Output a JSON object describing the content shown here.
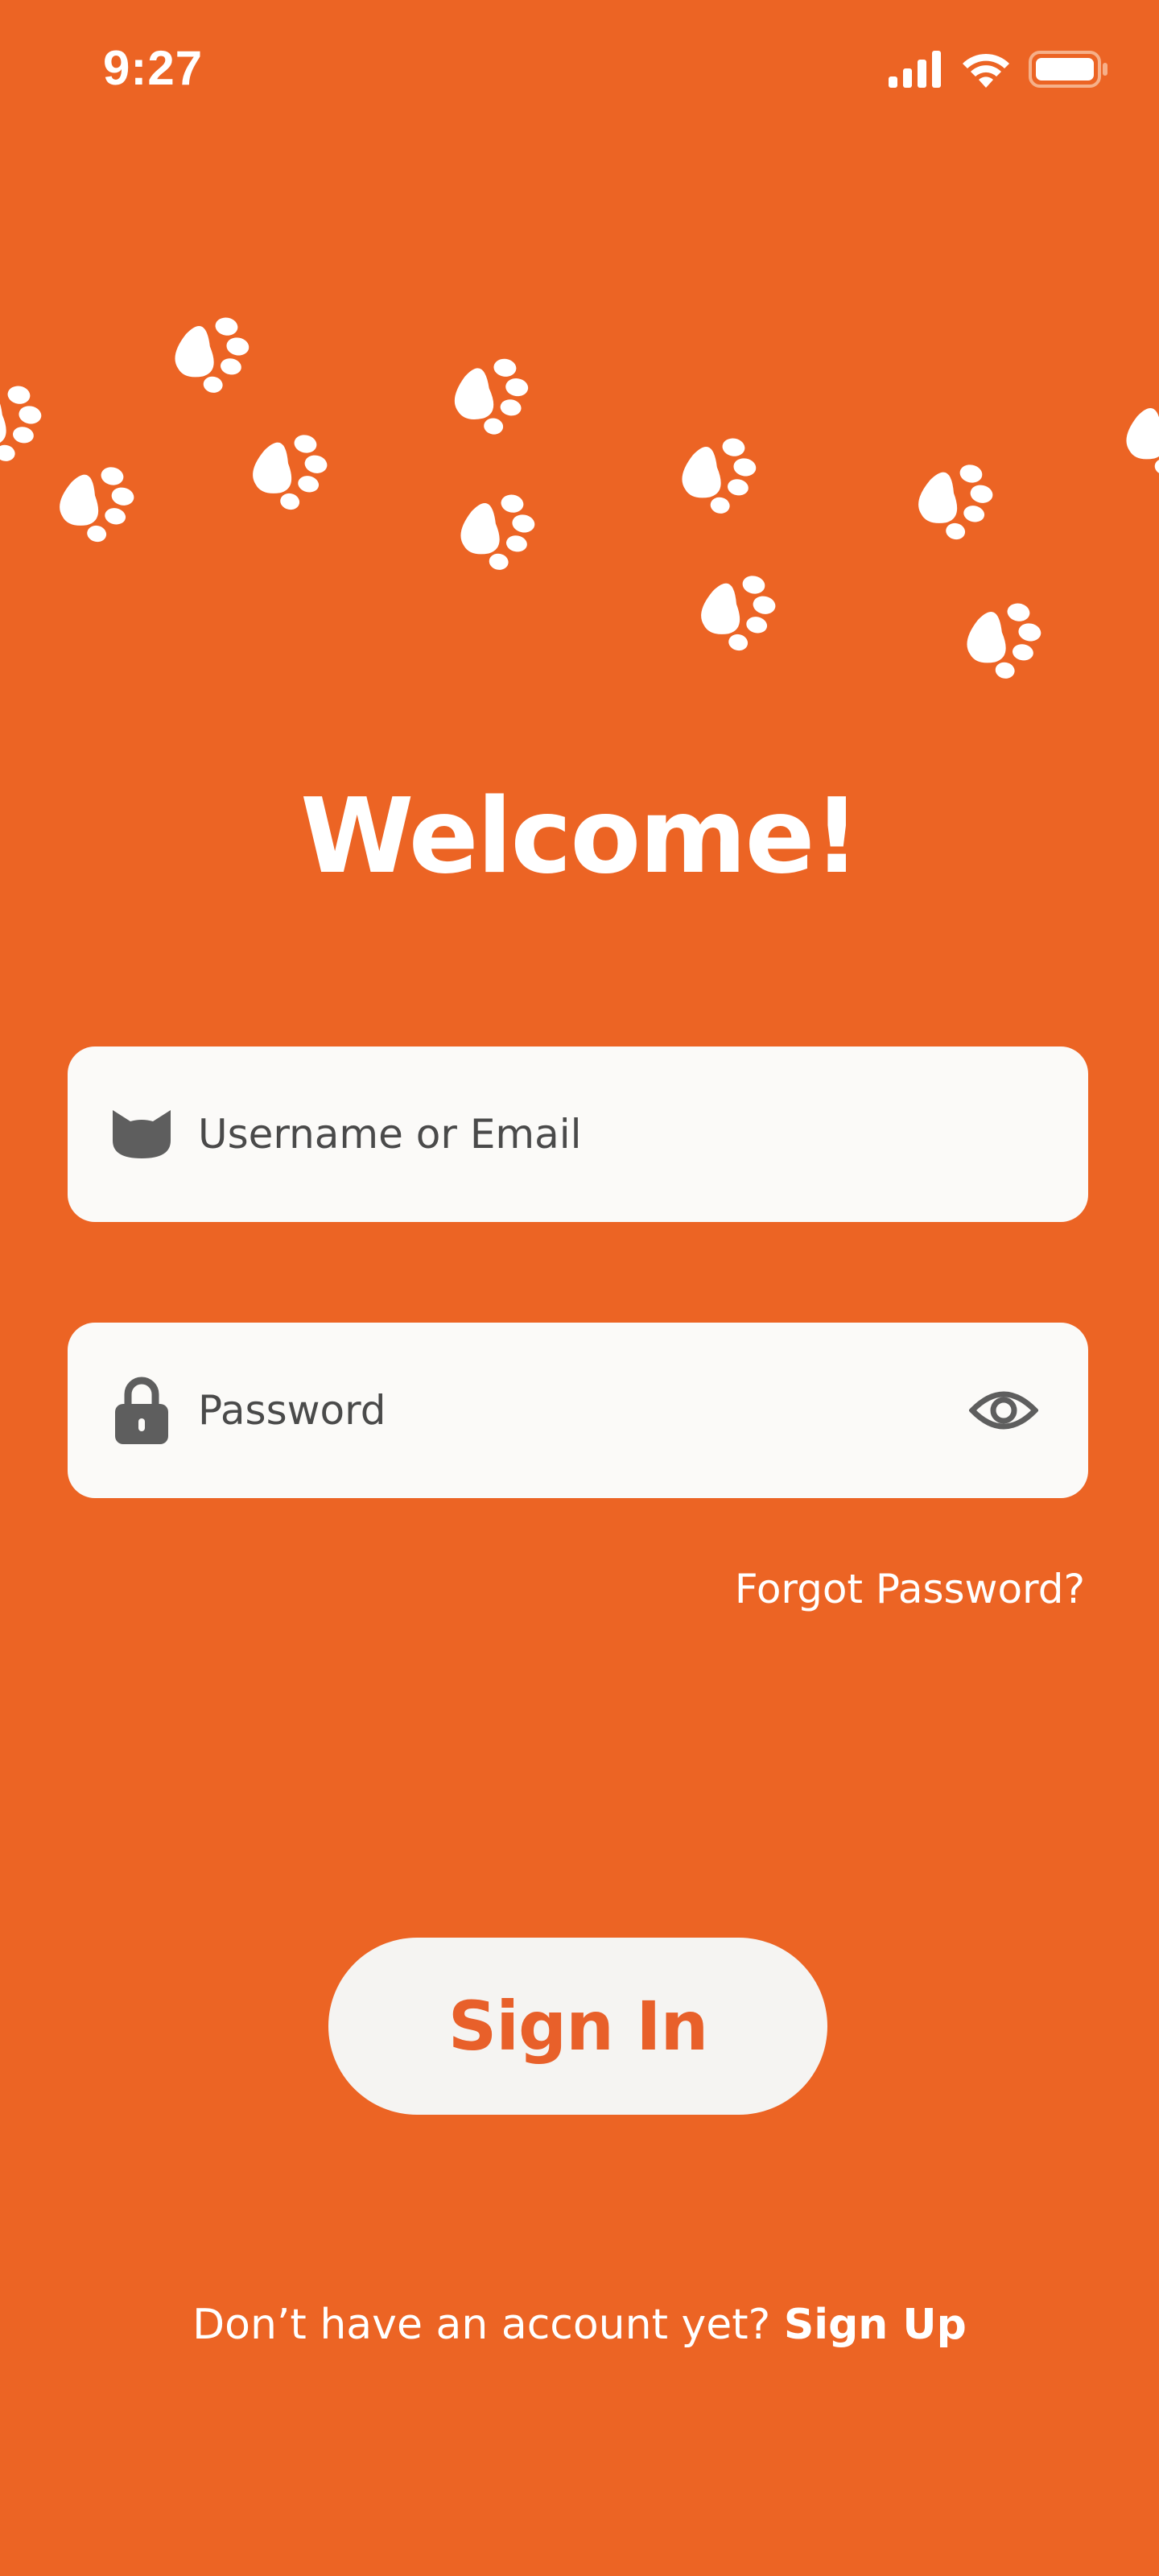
{
  "status_bar": {
    "time": "9:27",
    "icons": [
      "cellular-signal-icon",
      "wifi-icon",
      "battery-icon"
    ]
  },
  "decor": {
    "icon": "paw-print-icon",
    "color": "#FFFFFF"
  },
  "header": {
    "title": "Welcome!"
  },
  "form": {
    "username": {
      "placeholder": "Username or Email",
      "icon": "cat-face-icon"
    },
    "password": {
      "placeholder": "Password",
      "icon": "lock-icon",
      "toggle_icon": "eye-icon"
    },
    "forgot_label": "Forgot Password?",
    "submit_label": "Sign In"
  },
  "footer": {
    "prompt": "Don’t have an account yet?",
    "signup_label": "Sign Up"
  },
  "colors": {
    "background": "#EC6424",
    "field_bg": "#FBFAF8",
    "button_bg": "#F5F4F2",
    "button_text": "#E8602A",
    "icon_gray": "#5E5E5E"
  }
}
